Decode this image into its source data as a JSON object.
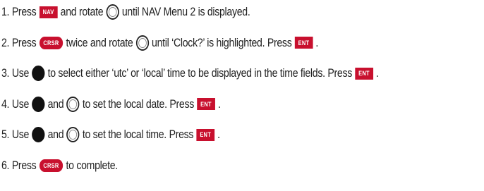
{
  "colors": {
    "accent": "#c8102e",
    "text": "#222222"
  },
  "steps": [
    [
      {
        "t": "text",
        "v": "1. Press"
      },
      {
        "t": "key",
        "style": "rect",
        "v": "NAV",
        "icon": "nav-key-icon"
      },
      {
        "t": "text",
        "v": "and rotate"
      },
      {
        "t": "knob",
        "kind": "outer",
        "icon": "outer-knob-icon"
      },
      {
        "t": "text",
        "v": "until NAV Menu 2 is displayed."
      }
    ],
    [
      {
        "t": "text",
        "v": "2. Press"
      },
      {
        "t": "key",
        "style": "oval",
        "v": "CRSR",
        "icon": "crsr-key-icon"
      },
      {
        "t": "text",
        "v": "twice and rotate"
      },
      {
        "t": "knob",
        "kind": "outer",
        "icon": "outer-knob-icon"
      },
      {
        "t": "text",
        "v": "until ‘Clock?’ is highlighted. Press"
      },
      {
        "t": "key",
        "style": "rect",
        "v": "ENT",
        "icon": "ent-key-icon"
      },
      {
        "t": "text",
        "v": "."
      }
    ],
    [
      {
        "t": "text",
        "v": "3. Use"
      },
      {
        "t": "knob",
        "kind": "inner",
        "icon": "inner-knob-icon"
      },
      {
        "t": "text",
        "v": "to select either ‘utc’ or ‘local’ time to be displayed in the time fields. Press"
      },
      {
        "t": "key",
        "style": "rect",
        "v": "ENT",
        "icon": "ent-key-icon"
      },
      {
        "t": "text",
        "v": "."
      }
    ],
    [
      {
        "t": "text",
        "v": "4. Use"
      },
      {
        "t": "knob",
        "kind": "inner",
        "icon": "inner-knob-icon"
      },
      {
        "t": "text",
        "v": "and"
      },
      {
        "t": "knob",
        "kind": "outer",
        "icon": "outer-knob-icon"
      },
      {
        "t": "text",
        "v": "to set the local date. Press"
      },
      {
        "t": "key",
        "style": "rect",
        "v": "ENT",
        "icon": "ent-key-icon"
      },
      {
        "t": "text",
        "v": "."
      }
    ],
    [
      {
        "t": "text",
        "v": "5. Use"
      },
      {
        "t": "knob",
        "kind": "inner",
        "icon": "inner-knob-icon"
      },
      {
        "t": "text",
        "v": "and"
      },
      {
        "t": "knob",
        "kind": "outer",
        "icon": "outer-knob-icon"
      },
      {
        "t": "text",
        "v": "to set the local time. Press"
      },
      {
        "t": "key",
        "style": "rect",
        "v": "ENT",
        "icon": "ent-key-icon"
      },
      {
        "t": "text",
        "v": "."
      }
    ],
    [
      {
        "t": "text",
        "v": "6. Press"
      },
      {
        "t": "key",
        "style": "oval",
        "v": "CRSR",
        "icon": "crsr-key-icon"
      },
      {
        "t": "text",
        "v": "to complete."
      }
    ]
  ]
}
